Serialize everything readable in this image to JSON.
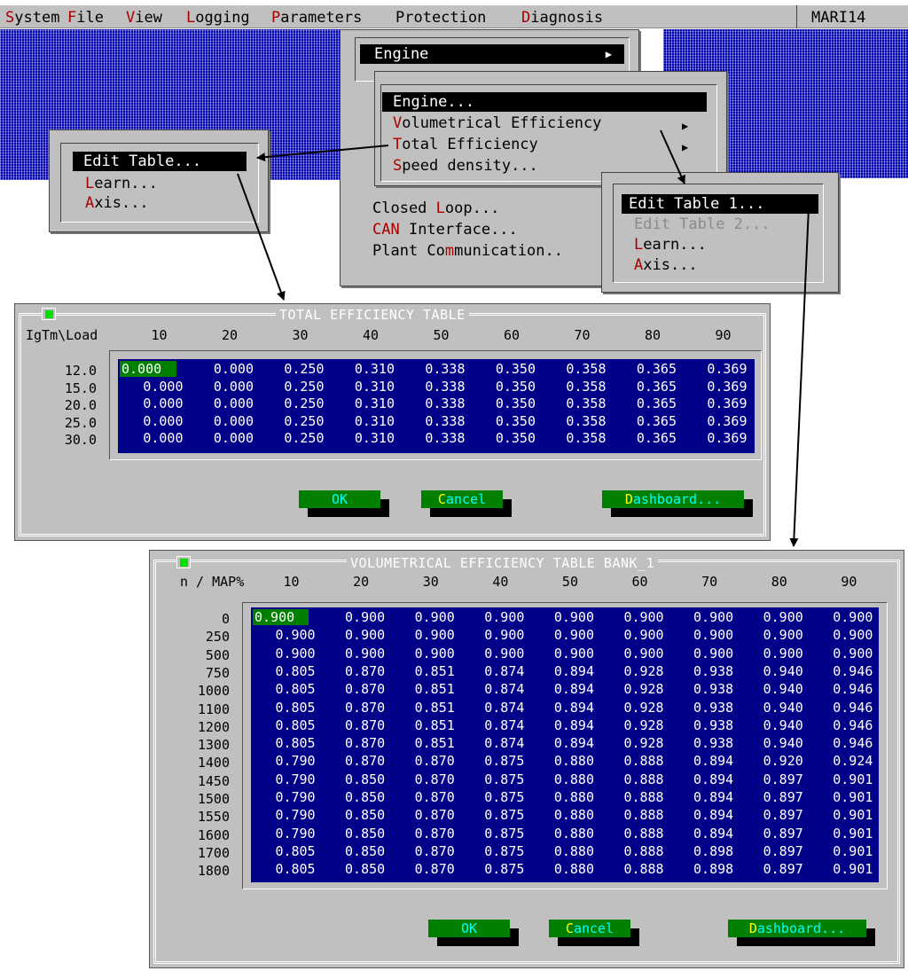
{
  "menubar": {
    "items": [
      {
        "hot": "S",
        "rest": "ystem"
      },
      {
        "hot": "F",
        "rest": "ile"
      },
      {
        "hot": "V",
        "rest": "iew"
      },
      {
        "hot": "L",
        "rest": "ogging"
      },
      {
        "hot": "P",
        "rest": "arameters"
      },
      {
        "hot": "",
        "rest": "Protection"
      },
      {
        "hot": "D",
        "rest": "iagnosis"
      }
    ],
    "system_name": "MARI14"
  },
  "params_menu": {
    "engine_header": "Engine",
    "engine_sub": {
      "engine": "Engine...",
      "vol_eff_hot": "V",
      "vol_eff_rest": "olumetrical Efficiency",
      "total_eff_hot": "T",
      "total_eff_rest": "otal Efficiency",
      "speed_density_hot": "S",
      "speed_density_rest": "peed density..."
    },
    "closed_loop_pre": "Closed ",
    "closed_loop_hot": "L",
    "closed_loop_post": "oop...",
    "can_hot": "CAN",
    "can_rest": " Interface...",
    "plant_pre": "Plant Co",
    "plant_hot": "m",
    "plant_post": "munication.."
  },
  "total_eff_submenu": {
    "edit_table": "Edit Table...",
    "learn_hot": "L",
    "learn_rest": "earn...",
    "axis_hot": "A",
    "axis_rest": "xis..."
  },
  "vol_eff_submenu": {
    "edit_table_1": "Edit Table 1...",
    "edit_table_2": "Edit Table 2...",
    "learn_hot": "L",
    "learn_rest": "earn...",
    "axis_hot": "A",
    "axis_rest": "xis..."
  },
  "total_eff_dialog": {
    "title": "TOTAL EFFICIENCY TABLE",
    "corner_label": "IgTm\\Load",
    "columns": [
      "10",
      "20",
      "30",
      "40",
      "50",
      "60",
      "70",
      "80",
      "90"
    ],
    "rows": [
      "12.0",
      "15.0",
      "20.0",
      "25.0",
      "30.0"
    ],
    "values": [
      [
        "0.000",
        "0.000",
        "0.250",
        "0.310",
        "0.338",
        "0.350",
        "0.358",
        "0.365",
        "0.369"
      ],
      [
        "0.000",
        "0.000",
        "0.250",
        "0.310",
        "0.338",
        "0.350",
        "0.358",
        "0.365",
        "0.369"
      ],
      [
        "0.000",
        "0.000",
        "0.250",
        "0.310",
        "0.338",
        "0.350",
        "0.358",
        "0.365",
        "0.369"
      ],
      [
        "0.000",
        "0.000",
        "0.250",
        "0.310",
        "0.338",
        "0.350",
        "0.358",
        "0.365",
        "0.369"
      ],
      [
        "0.000",
        "0.000",
        "0.250",
        "0.310",
        "0.338",
        "0.350",
        "0.358",
        "0.365",
        "0.369"
      ]
    ],
    "ok": "OK",
    "cancel_hot": "C",
    "cancel_rest": "ancel",
    "dashboard_hot": "D",
    "dashboard_rest": "ashboard..."
  },
  "vol_eff_dialog": {
    "title": "VOLUMETRICAL EFFICIENCY TABLE BANK_1",
    "corner_label": "n / MAP%",
    "columns": [
      "10",
      "20",
      "30",
      "40",
      "50",
      "60",
      "70",
      "80",
      "90"
    ],
    "rows": [
      "0",
      "250",
      "500",
      "750",
      "1000",
      "1100",
      "1200",
      "1300",
      "1400",
      "1450",
      "1500",
      "1550",
      "1600",
      "1700",
      "1800"
    ],
    "values": [
      [
        "0.900",
        "0.900",
        "0.900",
        "0.900",
        "0.900",
        "0.900",
        "0.900",
        "0.900",
        "0.900"
      ],
      [
        "0.900",
        "0.900",
        "0.900",
        "0.900",
        "0.900",
        "0.900",
        "0.900",
        "0.900",
        "0.900"
      ],
      [
        "0.900",
        "0.900",
        "0.900",
        "0.900",
        "0.900",
        "0.900",
        "0.900",
        "0.900",
        "0.900"
      ],
      [
        "0.805",
        "0.870",
        "0.851",
        "0.874",
        "0.894",
        "0.928",
        "0.938",
        "0.940",
        "0.946"
      ],
      [
        "0.805",
        "0.870",
        "0.851",
        "0.874",
        "0.894",
        "0.928",
        "0.938",
        "0.940",
        "0.946"
      ],
      [
        "0.805",
        "0.870",
        "0.851",
        "0.874",
        "0.894",
        "0.928",
        "0.938",
        "0.940",
        "0.946"
      ],
      [
        "0.805",
        "0.870",
        "0.851",
        "0.874",
        "0.894",
        "0.928",
        "0.938",
        "0.940",
        "0.946"
      ],
      [
        "0.805",
        "0.870",
        "0.851",
        "0.874",
        "0.894",
        "0.928",
        "0.938",
        "0.940",
        "0.946"
      ],
      [
        "0.790",
        "0.870",
        "0.870",
        "0.875",
        "0.880",
        "0.888",
        "0.894",
        "0.920",
        "0.924"
      ],
      [
        "0.790",
        "0.850",
        "0.870",
        "0.875",
        "0.880",
        "0.888",
        "0.894",
        "0.897",
        "0.901"
      ],
      [
        "0.790",
        "0.850",
        "0.870",
        "0.875",
        "0.880",
        "0.888",
        "0.894",
        "0.897",
        "0.901"
      ],
      [
        "0.790",
        "0.850",
        "0.870",
        "0.875",
        "0.880",
        "0.888",
        "0.894",
        "0.897",
        "0.901"
      ],
      [
        "0.790",
        "0.850",
        "0.870",
        "0.875",
        "0.880",
        "0.888",
        "0.894",
        "0.897",
        "0.901"
      ],
      [
        "0.805",
        "0.850",
        "0.870",
        "0.875",
        "0.880",
        "0.888",
        "0.898",
        "0.897",
        "0.901"
      ],
      [
        "0.805",
        "0.850",
        "0.870",
        "0.875",
        "0.880",
        "0.888",
        "0.898",
        "0.897",
        "0.901"
      ]
    ],
    "ok": "OK",
    "cancel_hot": "C",
    "cancel_rest": "ancel",
    "dashboard_hot": "D",
    "dashboard_rest": "ashboard..."
  },
  "colors": {
    "table_bg": "#000088",
    "selected_cell": "#008000",
    "button_face": "#008000",
    "hotkey": "#a80000",
    "panel": "#c0c0c0"
  }
}
